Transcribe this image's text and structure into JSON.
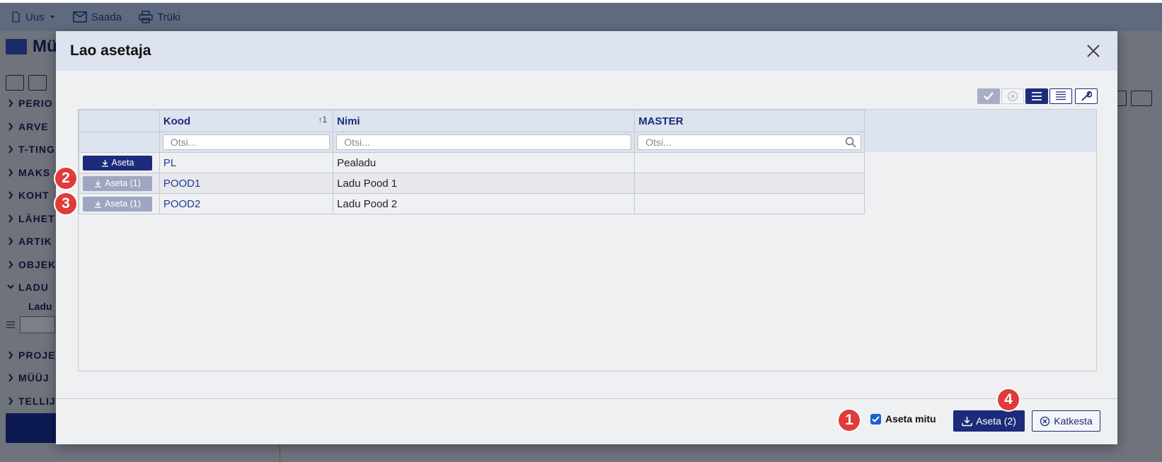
{
  "background": {
    "toolbar": {
      "new_label": "Uus",
      "send_label": "Saada",
      "print_label": "Trüki"
    },
    "page_title": "Mü",
    "sidebar_sections": [
      "PERIO",
      "ARVE",
      "T-TING",
      "MAKS",
      "KOHT",
      "LÄHET",
      "ARTIK",
      "OBJEK",
      "LADU",
      "PROJE",
      "MÜÜJ",
      "TELLIJ"
    ],
    "ladu_field_label": "Ladu"
  },
  "modal": {
    "title": "Lao asetaja",
    "columns": {
      "kood": "Kood",
      "nimi": "Nimi",
      "master": "MASTER"
    },
    "sort_indicator": "↑1",
    "search_placeholder": "Otsi...",
    "rows": [
      {
        "button": "Aseta",
        "kood": "PL",
        "nimi": "Pealadu",
        "master": ""
      },
      {
        "button": "Aseta (1)",
        "kood": "POOD1",
        "nimi": "Ladu Pood 1",
        "master": ""
      },
      {
        "button": "Aseta (1)",
        "kood": "POOD2",
        "nimi": "Ladu Pood 2",
        "master": ""
      }
    ],
    "footer": {
      "multi_checkbox_label": "Aseta mitu",
      "multi_checked": true,
      "primary_label": "Aseta (2)",
      "cancel_label": "Katkesta"
    },
    "badges": [
      "1",
      "2",
      "3",
      "4"
    ]
  },
  "colors": {
    "accent": "#1c2b7a",
    "badge": "#e03a3a",
    "link": "#233a9a"
  }
}
